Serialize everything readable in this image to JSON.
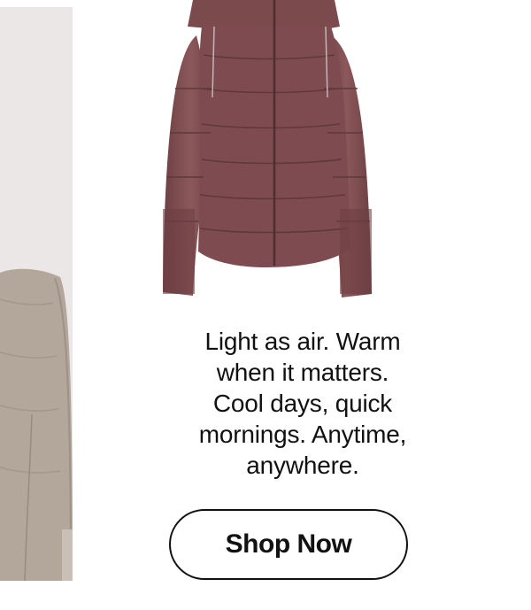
{
  "colors": {
    "jacket": "#7a4a4d",
    "left_background": "#ebe7e6",
    "left_jacket": "#b3a79c",
    "text": "#111111"
  },
  "product": {
    "image_icon": "puffer-jacket-icon",
    "tagline_lines": [
      "Light as air. Warm",
      "when it matters.",
      "Cool days, quick",
      "mornings. Anytime,",
      "anywhere."
    ],
    "cta_label": "Shop Now"
  },
  "left_photo": {
    "image_icon": "model-wearing-jacket-icon"
  }
}
